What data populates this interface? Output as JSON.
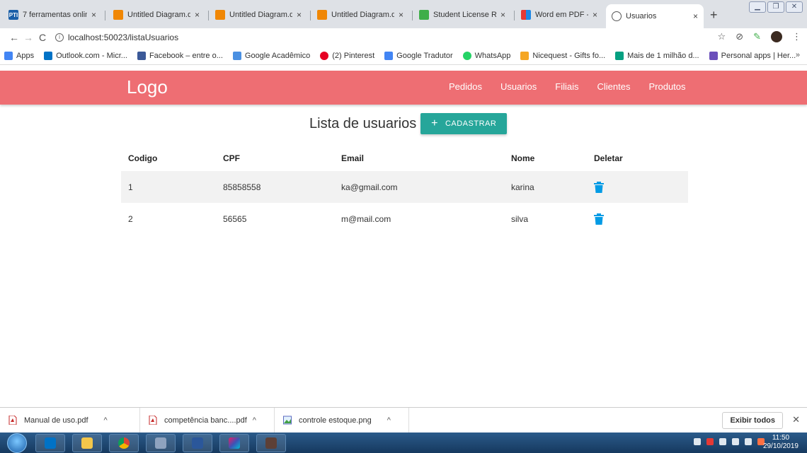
{
  "browser": {
    "tabs": [
      {
        "title": "7 ferramentas onlin",
        "icon": "pti-icon",
        "color": "#1b5fa8",
        "glyph": "PTI"
      },
      {
        "title": "Untitled Diagram.d",
        "icon": "drawio-icon",
        "color": "#f08705",
        "glyph": ""
      },
      {
        "title": "Untitled Diagram.d",
        "icon": "drawio-icon",
        "color": "#f08705",
        "glyph": ""
      },
      {
        "title": "Untitled Diagram.d",
        "icon": "drawio-icon",
        "color": "#f08705",
        "glyph": ""
      },
      {
        "title": "Student License Re",
        "icon": "license-icon",
        "color": "#3fae49",
        "glyph": ""
      },
      {
        "title": "Word em PDF - Co",
        "icon": "pdf-converter-icon",
        "color": "#e53935",
        "glyph": ""
      },
      {
        "title": "Usuarios",
        "icon": "globe-icon",
        "color": "#555555",
        "glyph": ""
      }
    ],
    "url": "localhost:50023/listaUsuarios",
    "bookmarks": [
      {
        "label": "Apps",
        "color": "#4285f4"
      },
      {
        "label": "Outlook.com - Micr...",
        "color": "#0072c6"
      },
      {
        "label": "Facebook – entre o...",
        "color": "#3b5998"
      },
      {
        "label": "Google Acadêmico",
        "color": "#4a90e2"
      },
      {
        "label": "(2) Pinterest",
        "color": "#e60023"
      },
      {
        "label": "Google Tradutor",
        "color": "#4285f4"
      },
      {
        "label": "WhatsApp",
        "color": "#25d366"
      },
      {
        "label": "Nicequest - Gifts fo...",
        "color": "#f5a623"
      },
      {
        "label": "Mais de 1 milhão d...",
        "color": "#05a081"
      },
      {
        "label": "Personal apps | Her...",
        "color": "#6b4fbb"
      }
    ],
    "bookmarks_more": "»"
  },
  "page": {
    "logo": "Logo",
    "nav": [
      "Pedidos",
      "Usuarios",
      "Filiais",
      "Clientes",
      "Produtos"
    ],
    "heading": "Lista de usuarios",
    "add_button": {
      "plus": "+",
      "label": "CADASTRAR"
    },
    "table": {
      "headers": [
        "Codigo",
        "CPF",
        "Email",
        "Nome",
        "Deletar"
      ],
      "rows": [
        {
          "codigo": "1",
          "cpf": "85858558",
          "email": "ka@gmail.com",
          "nome": "karina"
        },
        {
          "codigo": "2",
          "cpf": "56565",
          "email": "m@mail.com",
          "nome": "silva"
        }
      ]
    },
    "colors": {
      "navbar": "#ee6e73",
      "accent_button": "#26a69a",
      "delete_icon": "#039be5"
    }
  },
  "downloads": {
    "items": [
      {
        "name": "Manual de uso.pdf",
        "icon": "pdf-file-icon"
      },
      {
        "name": "competência banc....pdf",
        "icon": "pdf-file-icon"
      },
      {
        "name": "controle estoque.png",
        "icon": "image-file-icon"
      }
    ],
    "show_all": "Exibir todos",
    "close": "✕"
  },
  "taskbar": {
    "time": "11:50",
    "date": "29/10/2019"
  }
}
